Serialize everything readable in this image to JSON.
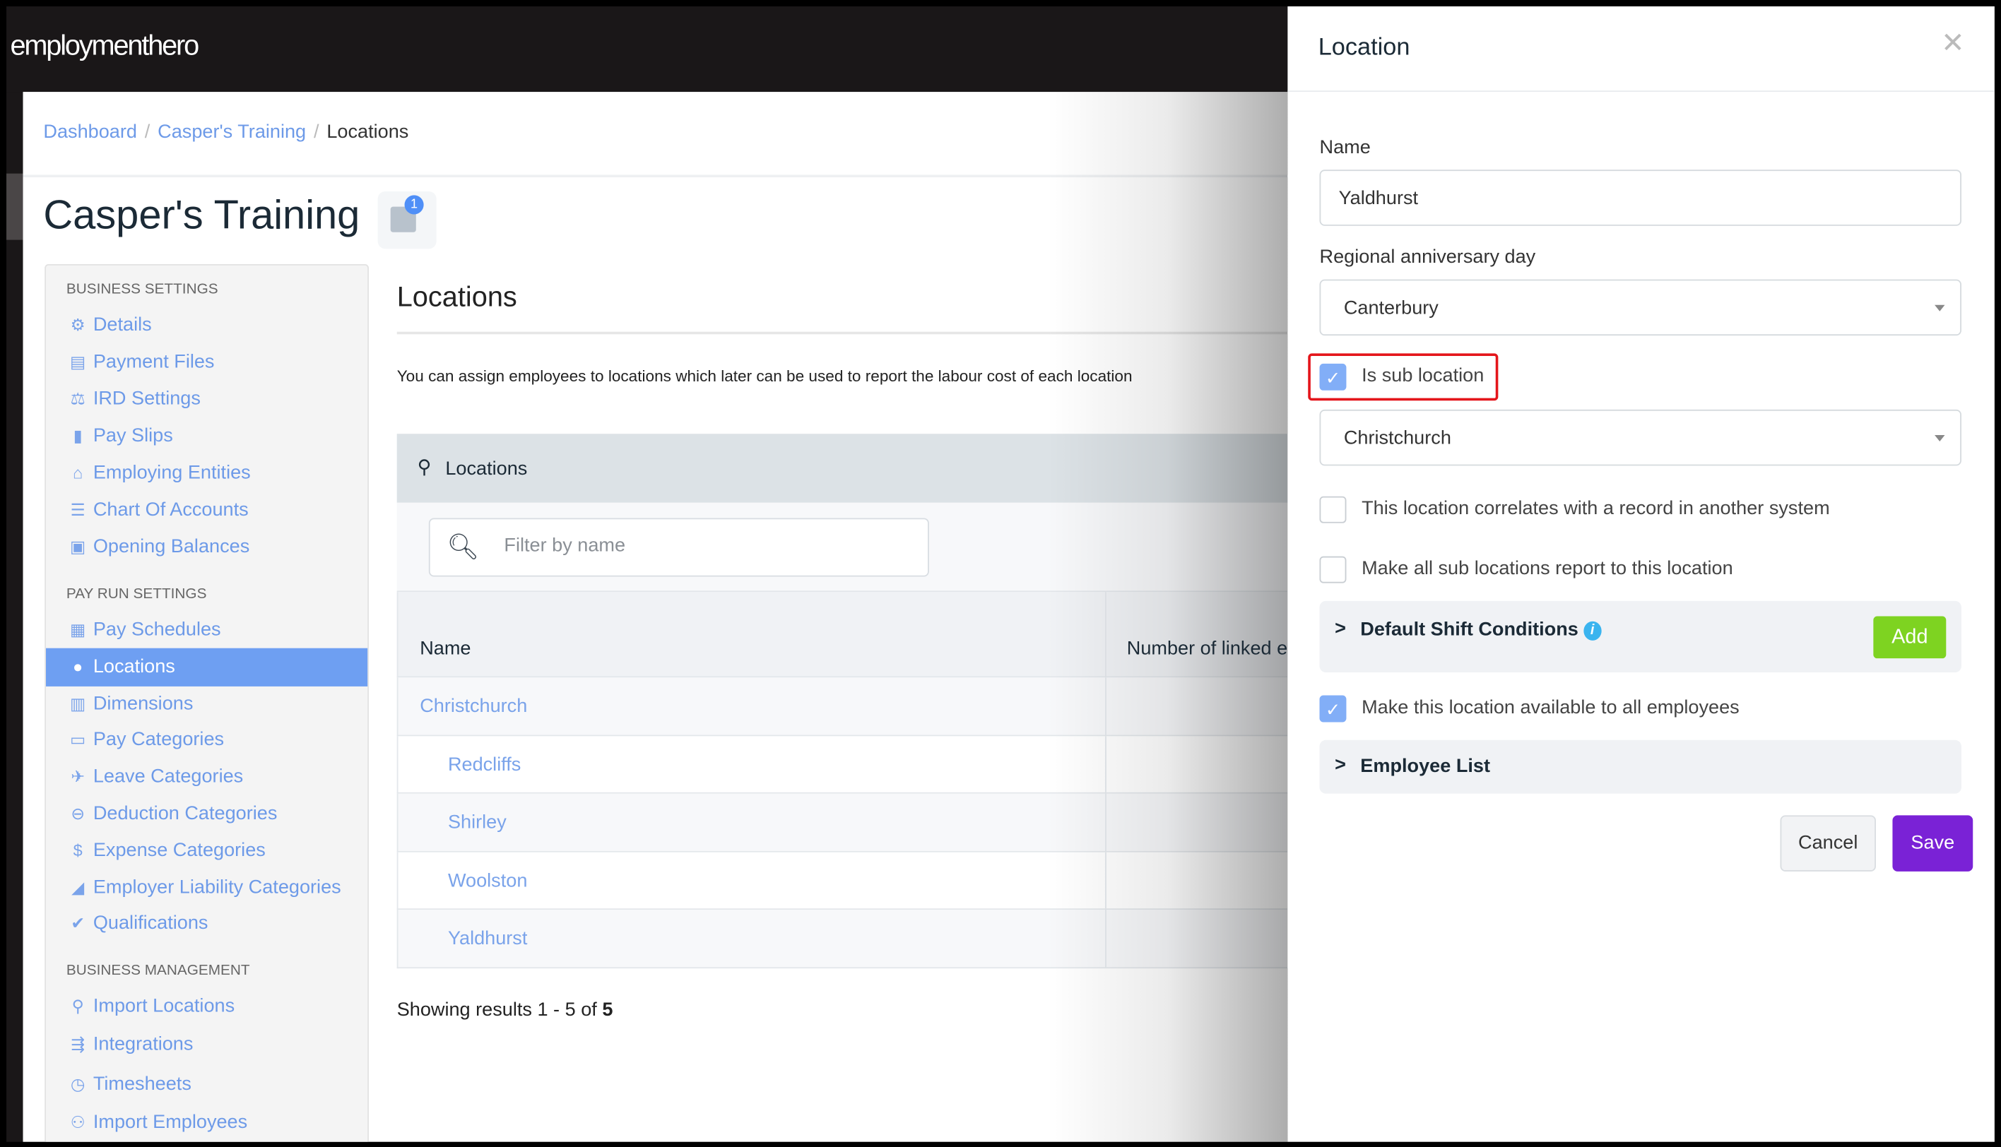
{
  "app": {
    "logo": "employmenthero"
  },
  "breadcrumb": [
    {
      "label": "Dashboard"
    },
    {
      "label": "Casper's Training"
    },
    {
      "label": "Locations"
    }
  ],
  "page": {
    "title": "Casper's Training",
    "notes_badge": "1"
  },
  "sidebar": {
    "sections": [
      {
        "header": "BUSINESS SETTINGS",
        "items": [
          {
            "label": "Details",
            "icon": "gear-icon",
            "glyph": "⚙"
          },
          {
            "label": "Payment Files",
            "icon": "floppy-icon",
            "glyph": "▤"
          },
          {
            "label": "IRD Settings",
            "icon": "scales-icon",
            "glyph": "⚖"
          },
          {
            "label": "Pay Slips",
            "icon": "file-icon",
            "glyph": "▮"
          },
          {
            "label": "Employing Entities",
            "icon": "bank-icon",
            "glyph": "⌂"
          },
          {
            "label": "Chart Of Accounts",
            "icon": "list-icon",
            "glyph": "☰"
          },
          {
            "label": "Opening Balances",
            "icon": "balance-icon",
            "glyph": "▣"
          }
        ]
      },
      {
        "header": "PAY RUN SETTINGS",
        "items": [
          {
            "label": "Pay Schedules",
            "icon": "calendar-icon",
            "glyph": "▦"
          },
          {
            "label": "Locations",
            "icon": "globe-icon",
            "glyph": "●",
            "active": true
          },
          {
            "label": "Dimensions",
            "icon": "bar-chart-icon",
            "glyph": "▥"
          },
          {
            "label": "Pay Categories",
            "icon": "money-icon",
            "glyph": "▭"
          },
          {
            "label": "Leave Categories",
            "icon": "plane-icon",
            "glyph": "✈"
          },
          {
            "label": "Deduction Categories",
            "icon": "minus-circle-icon",
            "glyph": "⊖"
          },
          {
            "label": "Expense Categories",
            "icon": "dollar-icon",
            "glyph": "$"
          },
          {
            "label": "Employer Liability Categories",
            "icon": "area-chart-icon",
            "glyph": "◢"
          },
          {
            "label": "Qualifications",
            "icon": "check-icon",
            "glyph": "✔"
          }
        ]
      },
      {
        "header": "BUSINESS MANAGEMENT",
        "items": [
          {
            "label": "Import Locations",
            "icon": "map-pin-icon",
            "glyph": "⚲"
          },
          {
            "label": "Integrations",
            "icon": "plug-icon",
            "glyph": "⇶"
          },
          {
            "label": "Timesheets",
            "icon": "clock-icon",
            "glyph": "◷"
          },
          {
            "label": "Import Employees",
            "icon": "users-icon",
            "glyph": "⚇"
          }
        ]
      }
    ]
  },
  "main": {
    "heading": "Locations",
    "description": "You can assign employees to locations which later can be used to report the labour cost of each location",
    "panel_title": "Locations",
    "filter_placeholder": "Filter by name",
    "columns": [
      "Name",
      "Number of linked e"
    ],
    "rows": [
      {
        "name": "Christchurch",
        "sub": false
      },
      {
        "name": "Redcliffs",
        "sub": true
      },
      {
        "name": "Shirley",
        "sub": true
      },
      {
        "name": "Woolston",
        "sub": true
      },
      {
        "name": "Yaldhurst",
        "sub": true
      }
    ],
    "showing_prefix": "Showing results 1 - 5 of ",
    "showing_total": "5"
  },
  "drawer": {
    "title": "Location",
    "name_label": "Name",
    "name_value": "Yaldhurst",
    "anniversary_label": "Regional anniversary day",
    "anniversary_value": "Canterbury",
    "is_sub_label": "Is sub location",
    "is_sub_checked": true,
    "parent_value": "Christchurch",
    "correlates_label": "This location correlates with a record in another system",
    "correlates_checked": false,
    "report_label": "Make all sub locations report to this location",
    "report_checked": false,
    "shift_conditions_label": "Default Shift Conditions",
    "add_label": "Add",
    "available_label": "Make this location available to all employees",
    "available_checked": true,
    "employee_list_label": "Employee List",
    "cancel_label": "Cancel",
    "save_label": "Save"
  },
  "colors": {
    "link": "#6d9ae8",
    "active_nav": "#6e9ff2",
    "add": "#7ed321",
    "save": "#7a22d6",
    "highlight": "#e4151b"
  }
}
